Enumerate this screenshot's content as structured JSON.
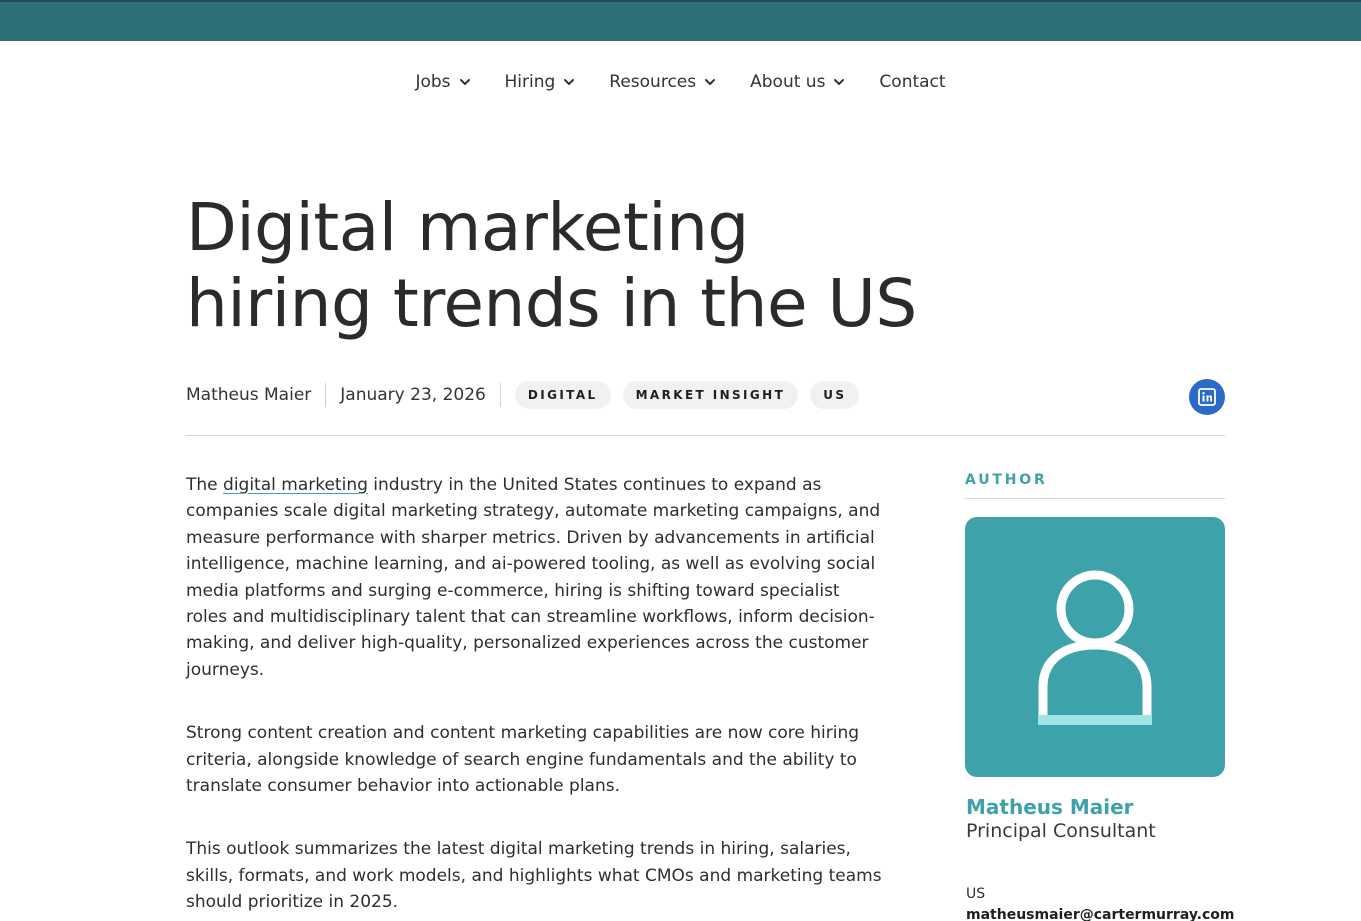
{
  "nav": {
    "items": [
      {
        "label": "Jobs",
        "has_dropdown": true
      },
      {
        "label": "Hiring",
        "has_dropdown": true
      },
      {
        "label": "Resources",
        "has_dropdown": true
      },
      {
        "label": "About us",
        "has_dropdown": true
      },
      {
        "label": "Contact",
        "has_dropdown": false
      }
    ]
  },
  "article": {
    "title_line1": "Digital marketing",
    "title_line2": "hiring trends in the US",
    "author": "Matheus Maier",
    "date": "January 23, 2026",
    "tags": [
      "DIGITAL",
      "MARKET INSIGHT",
      "US"
    ],
    "share_icon": "linkedin-icon",
    "paragraphs": [
      {
        "before_link": "The ",
        "link": "digital marketing",
        "after_link": " industry in the United States continues to expand as companies scale digital marketing strategy, automate marketing campaigns, and measure performance with sharper metrics. Driven by advancements in artificial intelligence, machine learning, and ai-powered tooling, as well as evolving social media platforms and surging e-commerce, hiring is shifting toward specialist roles and multidisciplinary talent that can streamline workflows, inform decision-making, and deliver high-quality, personalized experiences across the customer journeys."
      },
      {
        "text": "Strong content creation and content marketing capabilities are now core hiring criteria, alongside knowledge of search engine fundamentals and the ability to translate consumer behavior into actionable plans."
      },
      {
        "text": "This outlook summarizes the latest digital marketing trends in hiring, salaries, skills, formats, and work models, and highlights what CMOs and marketing teams should prioritize in 2025."
      }
    ]
  },
  "author_box": {
    "label": "AUTHOR",
    "name": "Matheus Maier",
    "role": "Principal Consultant",
    "location": "US",
    "email": "matheusmaier@cartermurray.com",
    "avatar_icon": "user-silhouette-icon"
  },
  "colors": {
    "top_bar": "#2d6f76",
    "accent": "#3ea2a9",
    "avatar_bg": "#3da2aa",
    "linkedin": "#2c6bc5"
  }
}
